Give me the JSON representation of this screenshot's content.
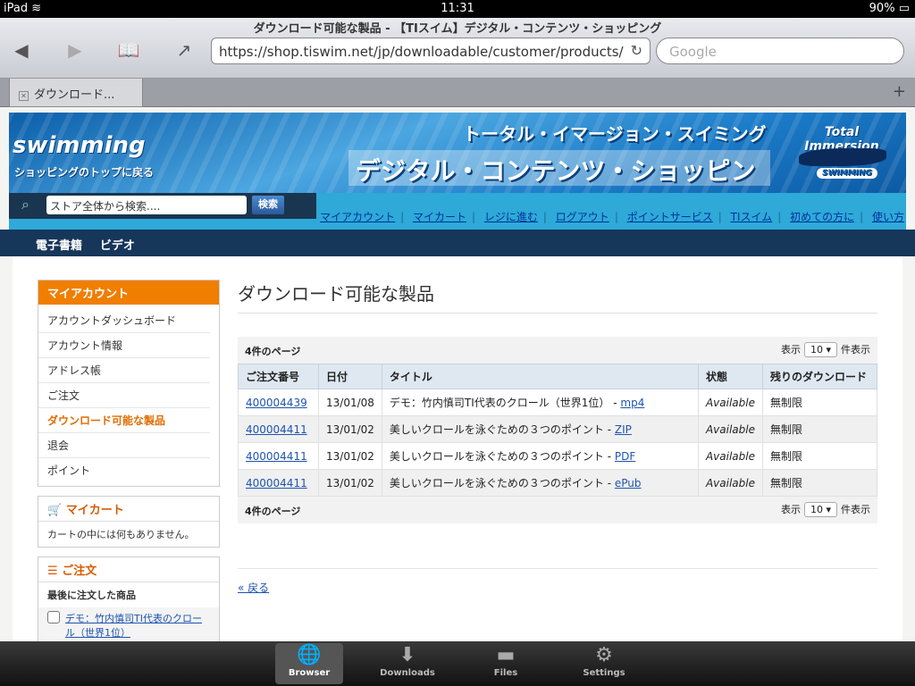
{
  "status": {
    "device": "iPad",
    "time": "11:31",
    "battery": "90%"
  },
  "browser": {
    "page_title": "ダウンロード可能な製品 - 【TIスイム】デジタル・コンテンツ・ショッピング",
    "url": "https://shop.tiswim.net/jp/downloadable/customer/products/",
    "search_placeholder": "Google",
    "tab_label": "ダウンロード..."
  },
  "banner": {
    "logo": "swimming",
    "logo_sub": "ショッピングのトップに戻る",
    "title1": "トータル・イマージョン・スイミング",
    "title2": "デジタル・コンテンツ・ショッピング",
    "ti_logo": "Total Immersion",
    "ti_sub": "SWIMMING"
  },
  "search": {
    "placeholder": "ストア全体から検索....",
    "button": "検索"
  },
  "toplinks": [
    "マイアカウント",
    "マイカート",
    "レジに進む",
    "ログアウト",
    "ポイントサービス",
    "TIスイム",
    "初めての方に",
    "使い方"
  ],
  "nav": [
    "電子書籍",
    "ビデオ"
  ],
  "sidebar": {
    "account_title": "マイアカウント",
    "account_items": [
      "アカウントダッシュボード",
      "アカウント情報",
      "アドレス帳",
      "ご注文",
      "ダウンロード可能な製品",
      "退会",
      "ポイント"
    ],
    "cart_title": "マイカート",
    "cart_text": "カートの中には何もありません。",
    "orders_title": "ご注文",
    "orders_head": "最後に注文した商品",
    "orders_item": "デモ：竹内慎司TI代表のクロール（世界1位）"
  },
  "main": {
    "title": "ダウンロード可能な製品",
    "pager_count": "4件のページ",
    "pager_label1": "表示",
    "pager_value": "10",
    "pager_label2": "件表示",
    "headers": [
      "ご注文番号",
      "日付",
      "タイトル",
      "状態",
      "残りのダウンロード"
    ],
    "rows": [
      {
        "order": "400004439",
        "date": "13/01/08",
        "title": "デモ：竹内慎司TI代表のクロール（世界1位） -",
        "link": "mp4",
        "status": "Available",
        "remaining": "無制限"
      },
      {
        "order": "400004411",
        "date": "13/01/02",
        "title": "美しいクロールを泳ぐための３つのポイント -",
        "link": "ZIP",
        "status": "Available",
        "remaining": "無制限"
      },
      {
        "order": "400004411",
        "date": "13/01/02",
        "title": "美しいクロールを泳ぐための３つのポイント -",
        "link": "PDF",
        "status": "Available",
        "remaining": "無制限"
      },
      {
        "order": "400004411",
        "date": "13/01/02",
        "title": "美しいクロールを泳ぐための３つのポイント -",
        "link": "ePub",
        "status": "Available",
        "remaining": "無制限"
      }
    ],
    "back": "« 戻る"
  },
  "dock": [
    "Browser",
    "Downloads",
    "Files",
    "Settings"
  ]
}
